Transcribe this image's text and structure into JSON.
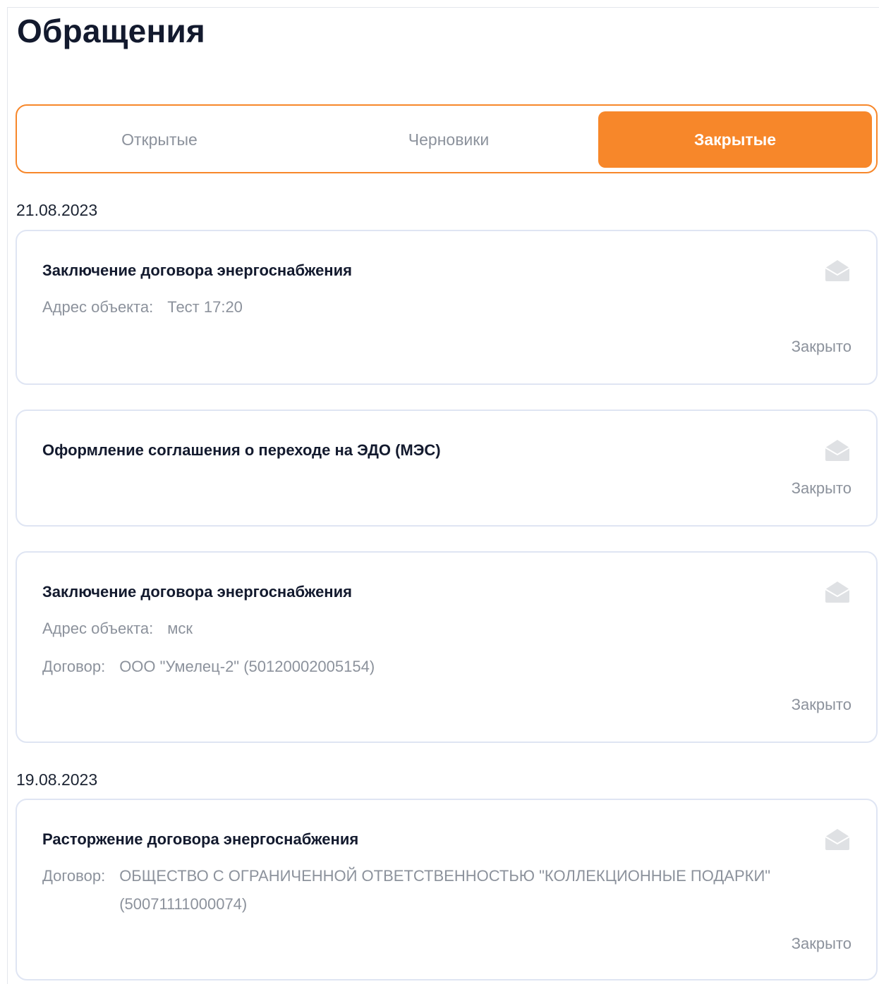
{
  "page": {
    "title": "Обращения"
  },
  "tabs": [
    {
      "label": "Открытые",
      "active": false
    },
    {
      "label": "Черновики",
      "active": false
    },
    {
      "label": "Закрытые",
      "active": true
    }
  ],
  "colors": {
    "accent": "#f7872a",
    "card_border": "#dfe5f3",
    "muted_text": "#8c929c"
  },
  "groups": [
    {
      "date": "21.08.2023",
      "cards": [
        {
          "title": "Заключение договора энергоснабжения",
          "rows": [
            {
              "label": "Адрес объекта:",
              "value": "Тест 17:20"
            }
          ],
          "status": "Закрыто",
          "icon": "open-envelope-icon"
        },
        {
          "title": "Оформление соглашения о переходе на ЭДО (МЭС)",
          "rows": [],
          "status": "Закрыто",
          "icon": "open-envelope-icon"
        },
        {
          "title": "Заключение договора энергоснабжения",
          "rows": [
            {
              "label": "Адрес объекта:",
              "value": "мск"
            },
            {
              "label": "Договор:",
              "value": "ООО \"Умелец-2\" (50120002005154)"
            }
          ],
          "status": "Закрыто",
          "icon": "open-envelope-icon"
        }
      ]
    },
    {
      "date": "19.08.2023",
      "cards": [
        {
          "title": "Расторжение договора энергоснабжения",
          "rows": [
            {
              "label": "Договор:",
              "value": "ОБЩЕСТВО С ОГРАНИЧЕННОЙ ОТВЕТСТВЕННОСТЬЮ \"КОЛЛЕКЦИОННЫЕ ПОДАРКИ\" (50071111000074)"
            }
          ],
          "status": "Закрыто",
          "icon": "open-envelope-icon"
        }
      ]
    }
  ]
}
